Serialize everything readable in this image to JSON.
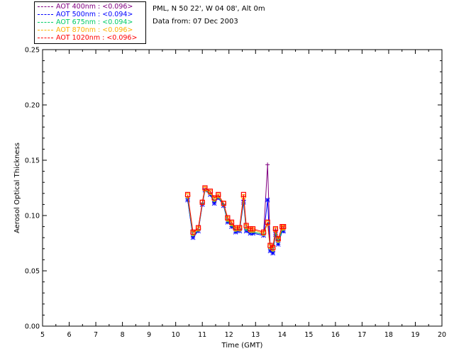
{
  "info": {
    "location": "PML, N 50 22', W 04 08', Alt 0m",
    "date": "Data from: 07 Dec 2003"
  },
  "chart_data": {
    "type": "line",
    "xlabel": "Time (GMT)",
    "ylabel": "Aerosol Optical Thickness",
    "xlim": [
      5,
      20
    ],
    "ylim": [
      0,
      0.25
    ],
    "xticks": [
      "5",
      "6",
      "7",
      "8",
      "9",
      "10",
      "11",
      "12",
      "13",
      "14",
      "15",
      "16",
      "17",
      "18",
      "19",
      "20"
    ],
    "yticks": [
      "0.00",
      "0.05",
      "0.10",
      "0.15",
      "0.20",
      "0.25"
    ],
    "grid": false,
    "legend_position": "top-left",
    "x": [
      10.45,
      10.65,
      10.85,
      11.0,
      11.1,
      11.3,
      11.45,
      11.6,
      11.8,
      11.95,
      12.1,
      12.25,
      12.4,
      12.55,
      12.65,
      12.8,
      12.9,
      13.3,
      13.45,
      13.55,
      13.65,
      13.75,
      13.85,
      14.0,
      14.05
    ],
    "series": [
      {
        "name": "AOT 400nm :",
        "mean": "<0.096>",
        "color": "#800080",
        "marker": "plus",
        "values": [
          0.114,
          0.081,
          0.087,
          0.11,
          0.123,
          0.12,
          0.112,
          0.117,
          0.109,
          0.096,
          0.092,
          0.087,
          0.088,
          0.114,
          0.088,
          0.086,
          0.085,
          0.083,
          0.146,
          0.07,
          0.067,
          0.087,
          0.078,
          0.088,
          0.088
        ]
      },
      {
        "name": "AOT 500nm :",
        "mean": "<0.094>",
        "color": "#0000ff",
        "marker": "star",
        "values": [
          0.114,
          0.08,
          0.086,
          0.11,
          0.123,
          0.119,
          0.111,
          0.116,
          0.109,
          0.094,
          0.09,
          0.085,
          0.086,
          0.112,
          0.086,
          0.084,
          0.084,
          0.082,
          0.114,
          0.068,
          0.066,
          0.083,
          0.074,
          0.086,
          0.086
        ]
      },
      {
        "name": "AOT 675nm :",
        "mean": "<0.094>",
        "color": "#00cc66",
        "marker": "dot",
        "values": [
          0.116,
          0.082,
          0.087,
          0.111,
          0.123,
          0.12,
          0.113,
          0.117,
          0.11,
          0.095,
          0.091,
          0.086,
          0.087,
          0.115,
          0.087,
          0.085,
          0.085,
          0.083,
          0.093,
          0.07,
          0.068,
          0.085,
          0.076,
          0.087,
          0.087
        ]
      },
      {
        "name": "AOT  870nm :",
        "mean": "<0.096>",
        "color": "#ffb000",
        "marker": "circle",
        "values": [
          0.118,
          0.084,
          0.088,
          0.112,
          0.124,
          0.121,
          0.115,
          0.118,
          0.111,
          0.097,
          0.093,
          0.088,
          0.088,
          0.117,
          0.09,
          0.087,
          0.087,
          0.084,
          0.093,
          0.072,
          0.07,
          0.087,
          0.078,
          0.089,
          0.089
        ]
      },
      {
        "name": "AOT 1020nm :",
        "mean": "<0.096>",
        "color": "#ff0000",
        "marker": "square",
        "values": [
          0.119,
          0.085,
          0.089,
          0.112,
          0.125,
          0.122,
          0.116,
          0.119,
          0.111,
          0.098,
          0.094,
          0.089,
          0.089,
          0.119,
          0.091,
          0.088,
          0.088,
          0.085,
          0.094,
          0.073,
          0.071,
          0.088,
          0.079,
          0.09,
          0.09
        ]
      }
    ]
  }
}
